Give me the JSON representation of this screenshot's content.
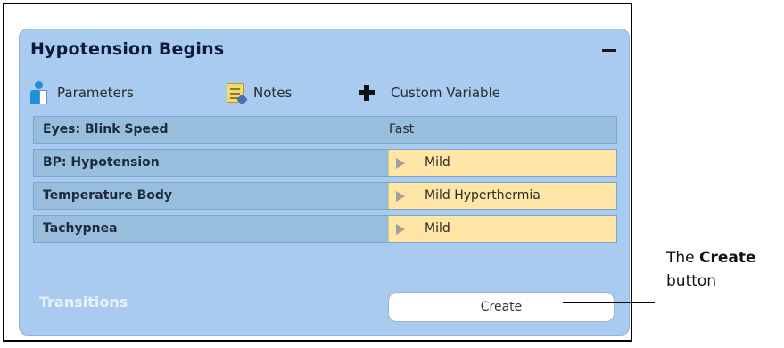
{
  "panel": {
    "title": "Hypotension Begins",
    "collapse_icon": "minus-icon"
  },
  "toolbar": {
    "parameters_label": "Parameters",
    "notes_label": "Notes",
    "custom_variable_label": "Custom Variable"
  },
  "rows": [
    {
      "name": "Eyes: Blink Speed",
      "value": "Fast",
      "editable": false
    },
    {
      "name": "BP: Hypotension",
      "value": "Mild",
      "editable": true
    },
    {
      "name": "Temperature Body",
      "value": "Mild Hyperthermia",
      "editable": true
    },
    {
      "name": "Tachypnea",
      "value": "Mild",
      "editable": true
    }
  ],
  "transitions": {
    "label": "Transitions",
    "create_label": "Create"
  },
  "callout": {
    "prefix": "The",
    "bold": "Create",
    "suffix": "button"
  },
  "colors": {
    "panel_bg": "#aacbf0",
    "row_bg": "#98bedd",
    "editable_value_bg": "#ffe6a6"
  }
}
